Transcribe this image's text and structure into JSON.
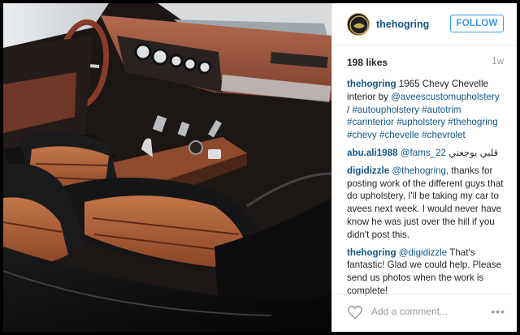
{
  "post": {
    "username": "thehogring",
    "follow_label": "FOLLOW",
    "likes": "198 likes",
    "time": "1w",
    "add_comment_placeholder": "Add a comment...",
    "more_icon": "•••"
  },
  "comments": [
    {
      "user": "thehogring",
      "text_1": "1965 Chevy Chevelle interior by",
      "link_1": "@aveescustomupholstery",
      "text_2": " /",
      "tags": [
        "#autoupholstery",
        "#autotrim",
        "#carinterior",
        "#upholstery",
        "#thehogring",
        "#chevy",
        "#chevelle",
        "#chevrolet"
      ]
    },
    {
      "user": "abu.ali1988",
      "mention": "@fams_22",
      "text": "قلبي يوجعني"
    },
    {
      "user": "digidizzle",
      "mention": "@thehogring",
      "text": ", thanks for posting work of the different guys that do upholstery. I'll be taking my car to avees next week. I would never have know he was just over the hill if you didn't post this."
    },
    {
      "user": "thehogring",
      "mention": "@digidizzle",
      "text": " That's fantastic! Glad we could help. Please send us photos when the work is complete!"
    }
  ],
  "colors": {
    "link": "#125688",
    "follow": "#3897f0",
    "leather": "#b5653c"
  }
}
